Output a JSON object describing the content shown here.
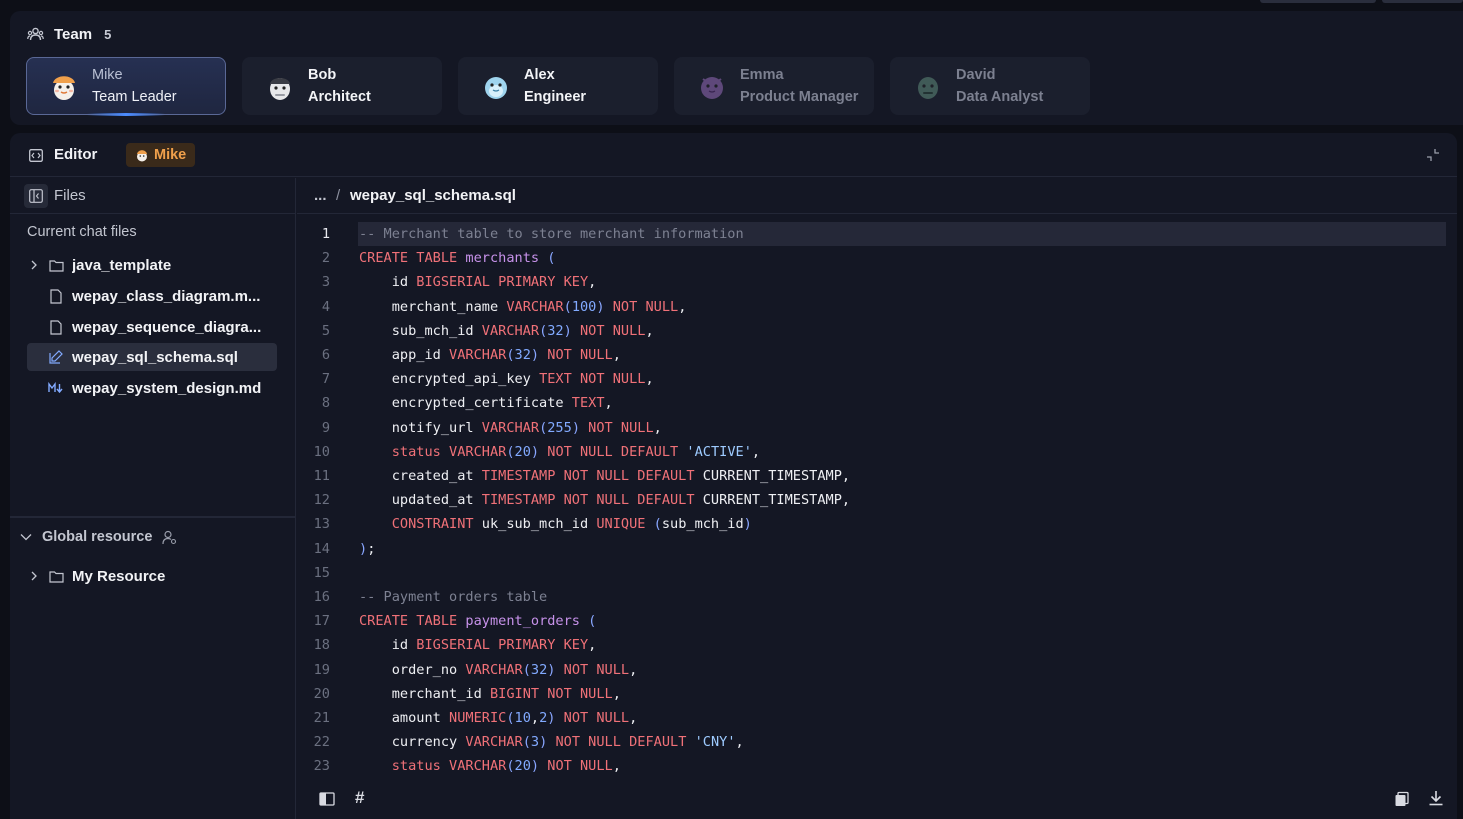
{
  "team": {
    "title": "Team",
    "count": "5",
    "members": [
      {
        "name": "Mike",
        "role": "Team Leader"
      },
      {
        "name": "Bob",
        "role": "Architect"
      },
      {
        "name": "Alex",
        "role": "Engineer"
      },
      {
        "name": "Emma",
        "role": "Product Manager"
      },
      {
        "name": "David",
        "role": "Data Analyst"
      }
    ]
  },
  "editor": {
    "title": "Editor",
    "owner": "Mike"
  },
  "sidebar": {
    "files_label": "Files",
    "current_chat_files_label": "Current chat files",
    "items": [
      {
        "label": "java_template",
        "type": "folder"
      },
      {
        "label": "wepay_class_diagram.m...",
        "type": "file"
      },
      {
        "label": "wepay_sequence_diagra...",
        "type": "file"
      },
      {
        "label": "wepay_sql_schema.sql",
        "type": "file-edit"
      },
      {
        "label": "wepay_system_design.md",
        "type": "markdown"
      }
    ],
    "global_resource_label": "Global resource",
    "global_items": [
      {
        "label": "My Resource",
        "type": "folder"
      }
    ]
  },
  "breadcrumb": {
    "ellipsis": "...",
    "separator": "/",
    "file": "wepay_sql_schema.sql"
  },
  "code": {
    "current_line": 1,
    "lines": [
      [
        [
          "cm",
          "-- Merchant table to store merchant information"
        ]
      ],
      [
        [
          "kw",
          "CREATE TABLE "
        ],
        [
          "nm",
          "merchants "
        ],
        [
          "pu",
          "("
        ]
      ],
      [
        [
          "id",
          "    id "
        ],
        [
          "kw",
          "BIGSERIAL PRIMARY KEY"
        ],
        [
          "id",
          ","
        ]
      ],
      [
        [
          "id",
          "    merchant_name "
        ],
        [
          "kw",
          "VARCHAR"
        ],
        [
          "pu",
          "("
        ],
        [
          "num",
          "100"
        ],
        [
          "pu",
          ")"
        ],
        [
          "kw",
          " NOT NULL"
        ],
        [
          "id",
          ","
        ]
      ],
      [
        [
          "id",
          "    sub_mch_id "
        ],
        [
          "kw",
          "VARCHAR"
        ],
        [
          "pu",
          "("
        ],
        [
          "num",
          "32"
        ],
        [
          "pu",
          ")"
        ],
        [
          "kw",
          " NOT NULL"
        ],
        [
          "id",
          ","
        ]
      ],
      [
        [
          "id",
          "    app_id "
        ],
        [
          "kw",
          "VARCHAR"
        ],
        [
          "pu",
          "("
        ],
        [
          "num",
          "32"
        ],
        [
          "pu",
          ")"
        ],
        [
          "kw",
          " NOT NULL"
        ],
        [
          "id",
          ","
        ]
      ],
      [
        [
          "id",
          "    encrypted_api_key "
        ],
        [
          "kw",
          "TEXT NOT NULL"
        ],
        [
          "id",
          ","
        ]
      ],
      [
        [
          "id",
          "    encrypted_certificate "
        ],
        [
          "kw",
          "TEXT"
        ],
        [
          "id",
          ","
        ]
      ],
      [
        [
          "id",
          "    notify_url "
        ],
        [
          "kw",
          "VARCHAR"
        ],
        [
          "pu",
          "("
        ],
        [
          "num",
          "255"
        ],
        [
          "pu",
          ")"
        ],
        [
          "kw",
          " NOT NULL"
        ],
        [
          "id",
          ","
        ]
      ],
      [
        [
          "kw",
          "    status VARCHAR"
        ],
        [
          "pu",
          "("
        ],
        [
          "num",
          "20"
        ],
        [
          "pu",
          ")"
        ],
        [
          "kw",
          " NOT NULL DEFAULT "
        ],
        [
          "str2",
          "'ACTIVE'"
        ],
        [
          "id",
          ","
        ]
      ],
      [
        [
          "id",
          "    created_at "
        ],
        [
          "kw",
          "TIMESTAMP NOT NULL DEFAULT "
        ],
        [
          "id",
          "CURRENT_TIMESTAMP,"
        ]
      ],
      [
        [
          "id",
          "    updated_at "
        ],
        [
          "kw",
          "TIMESTAMP NOT NULL DEFAULT "
        ],
        [
          "id",
          "CURRENT_TIMESTAMP,"
        ]
      ],
      [
        [
          "kw",
          "    CONSTRAINT "
        ],
        [
          "id",
          "uk_sub_mch_id "
        ],
        [
          "kw",
          "UNIQUE "
        ],
        [
          "pu",
          "("
        ],
        [
          "id",
          "sub_mch_id"
        ],
        [
          "pu",
          ")"
        ]
      ],
      [
        [
          "pu",
          ")"
        ],
        [
          "id",
          ";"
        ]
      ],
      [
        [
          "id",
          ""
        ]
      ],
      [
        [
          "cm",
          "-- Payment orders table"
        ]
      ],
      [
        [
          "kw",
          "CREATE TABLE "
        ],
        [
          "nm",
          "payment_orders "
        ],
        [
          "pu",
          "("
        ]
      ],
      [
        [
          "id",
          "    id "
        ],
        [
          "kw",
          "BIGSERIAL PRIMARY KEY"
        ],
        [
          "id",
          ","
        ]
      ],
      [
        [
          "id",
          "    order_no "
        ],
        [
          "kw",
          "VARCHAR"
        ],
        [
          "pu",
          "("
        ],
        [
          "num",
          "32"
        ],
        [
          "pu",
          ")"
        ],
        [
          "kw",
          " NOT NULL"
        ],
        [
          "id",
          ","
        ]
      ],
      [
        [
          "id",
          "    merchant_id "
        ],
        [
          "kw",
          "BIGINT NOT NULL"
        ],
        [
          "id",
          ","
        ]
      ],
      [
        [
          "id",
          "    amount "
        ],
        [
          "kw",
          "NUMERIC"
        ],
        [
          "pu",
          "("
        ],
        [
          "num",
          "10"
        ],
        [
          "id",
          ","
        ],
        [
          "num",
          "2"
        ],
        [
          "pu",
          ")"
        ],
        [
          "kw",
          " NOT NULL"
        ],
        [
          "id",
          ","
        ]
      ],
      [
        [
          "id",
          "    currency "
        ],
        [
          "kw",
          "VARCHAR"
        ],
        [
          "pu",
          "("
        ],
        [
          "num",
          "3"
        ],
        [
          "pu",
          ")"
        ],
        [
          "kw",
          " NOT NULL DEFAULT "
        ],
        [
          "str2",
          "'CNY'"
        ],
        [
          "id",
          ","
        ]
      ],
      [
        [
          "kw",
          "    status VARCHAR"
        ],
        [
          "pu",
          "("
        ],
        [
          "num",
          "20"
        ],
        [
          "pu",
          ")"
        ],
        [
          "kw",
          " NOT NULL"
        ],
        [
          "id",
          ","
        ]
      ]
    ]
  },
  "footer": {
    "hash": "#"
  },
  "colors": {
    "accent": "#4b8bff",
    "owner_badge": "#f0a04b",
    "keyword": "#f07178",
    "name": "#c792ea",
    "number": "#82aaff",
    "comment": "#7d8192"
  }
}
